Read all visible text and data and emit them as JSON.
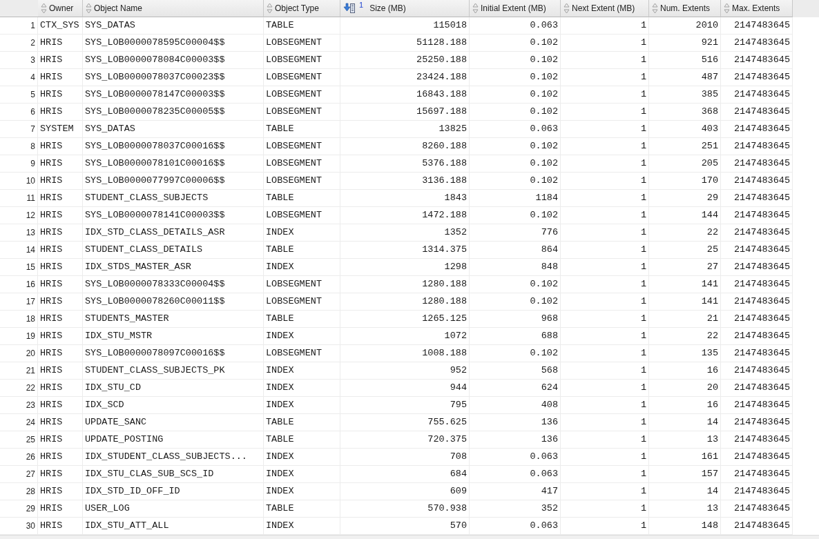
{
  "grid": {
    "columns": [
      {
        "label": "Owner",
        "kind": "text",
        "sorted": false
      },
      {
        "label": "Object Name",
        "kind": "text",
        "sorted": false
      },
      {
        "label": "Object Type",
        "kind": "text",
        "sorted": false
      },
      {
        "label": "Size (MB)",
        "kind": "number",
        "sorted": true,
        "sort_rank": "1"
      },
      {
        "label": "Initial Extent (MB)",
        "kind": "number",
        "sorted": false
      },
      {
        "label": "Next Extent (MB)",
        "kind": "number",
        "sorted": false
      },
      {
        "label": "Num. Extents",
        "kind": "number",
        "sorted": false
      },
      {
        "label": "Max. Extents",
        "kind": "number",
        "sorted": false
      }
    ],
    "rows": [
      {
        "number": "1",
        "cells": [
          "CTX_SYS",
          "SYS_DATAS",
          "TABLE",
          "115018",
          "0.063",
          "1",
          "2010",
          "2147483645"
        ]
      },
      {
        "number": "2",
        "cells": [
          "HRIS",
          "SYS_LOB0000078595C00004$$",
          "LOBSEGMENT",
          "51128.188",
          "0.102",
          "1",
          "921",
          "2147483645"
        ]
      },
      {
        "number": "3",
        "cells": [
          "HRIS",
          "SYS_LOB0000078084C00003$$",
          "LOBSEGMENT",
          "25250.188",
          "0.102",
          "1",
          "516",
          "2147483645"
        ]
      },
      {
        "number": "4",
        "cells": [
          "HRIS",
          "SYS_LOB0000078037C00023$$",
          "LOBSEGMENT",
          "23424.188",
          "0.102",
          "1",
          "487",
          "2147483645"
        ]
      },
      {
        "number": "5",
        "cells": [
          "HRIS",
          "SYS_LOB0000078147C00003$$",
          "LOBSEGMENT",
          "16843.188",
          "0.102",
          "1",
          "385",
          "2147483645"
        ]
      },
      {
        "number": "6",
        "cells": [
          "HRIS",
          "SYS_LOB0000078235C00005$$",
          "LOBSEGMENT",
          "15697.188",
          "0.102",
          "1",
          "368",
          "2147483645"
        ]
      },
      {
        "number": "7",
        "cells": [
          "SYSTEM",
          "SYS_DATAS",
          "TABLE",
          "13825",
          "0.063",
          "1",
          "403",
          "2147483645"
        ]
      },
      {
        "number": "8",
        "cells": [
          "HRIS",
          "SYS_LOB0000078037C00016$$",
          "LOBSEGMENT",
          "8260.188",
          "0.102",
          "1",
          "251",
          "2147483645"
        ]
      },
      {
        "number": "9",
        "cells": [
          "HRIS",
          "SYS_LOB0000078101C00016$$",
          "LOBSEGMENT",
          "5376.188",
          "0.102",
          "1",
          "205",
          "2147483645"
        ]
      },
      {
        "number": "10",
        "cells": [
          "HRIS",
          "SYS_LOB0000077997C00006$$",
          "LOBSEGMENT",
          "3136.188",
          "0.102",
          "1",
          "170",
          "2147483645"
        ]
      },
      {
        "number": "11",
        "cells": [
          "HRIS",
          "STUDENT_CLASS_SUBJECTS",
          "TABLE",
          "1843",
          "1184",
          "1",
          "29",
          "2147483645"
        ]
      },
      {
        "number": "12",
        "cells": [
          "HRIS",
          "SYS_LOB0000078141C00003$$",
          "LOBSEGMENT",
          "1472.188",
          "0.102",
          "1",
          "144",
          "2147483645"
        ]
      },
      {
        "number": "13",
        "cells": [
          "HRIS",
          "IDX_STD_CLASS_DETAILS_ASR",
          "INDEX",
          "1352",
          "776",
          "1",
          "22",
          "2147483645"
        ]
      },
      {
        "number": "14",
        "cells": [
          "HRIS",
          "STUDENT_CLASS_DETAILS",
          "TABLE",
          "1314.375",
          "864",
          "1",
          "25",
          "2147483645"
        ]
      },
      {
        "number": "15",
        "cells": [
          "HRIS",
          "IDX_STDS_MASTER_ASR",
          "INDEX",
          "1298",
          "848",
          "1",
          "27",
          "2147483645"
        ]
      },
      {
        "number": "16",
        "cells": [
          "HRIS",
          "SYS_LOB0000078333C00004$$",
          "LOBSEGMENT",
          "1280.188",
          "0.102",
          "1",
          "141",
          "2147483645"
        ]
      },
      {
        "number": "17",
        "cells": [
          "HRIS",
          "SYS_LOB0000078260C00011$$",
          "LOBSEGMENT",
          "1280.188",
          "0.102",
          "1",
          "141",
          "2147483645"
        ]
      },
      {
        "number": "18",
        "cells": [
          "HRIS",
          "STUDENTS_MASTER",
          "TABLE",
          "1265.125",
          "968",
          "1",
          "21",
          "2147483645"
        ]
      },
      {
        "number": "19",
        "cells": [
          "HRIS",
          "IDX_STU_MSTR",
          "INDEX",
          "1072",
          "688",
          "1",
          "22",
          "2147483645"
        ]
      },
      {
        "number": "20",
        "cells": [
          "HRIS",
          "SYS_LOB0000078097C00016$$",
          "LOBSEGMENT",
          "1008.188",
          "0.102",
          "1",
          "135",
          "2147483645"
        ]
      },
      {
        "number": "21",
        "cells": [
          "HRIS",
          "STUDENT_CLASS_SUBJECTS_PK",
          "INDEX",
          "952",
          "568",
          "1",
          "16",
          "2147483645"
        ]
      },
      {
        "number": "22",
        "cells": [
          "HRIS",
          "IDX_STU_CD",
          "INDEX",
          "944",
          "624",
          "1",
          "20",
          "2147483645"
        ]
      },
      {
        "number": "23",
        "cells": [
          "HRIS",
          "IDX_SCD",
          "INDEX",
          "795",
          "408",
          "1",
          "16",
          "2147483645"
        ]
      },
      {
        "number": "24",
        "cells": [
          "HRIS",
          "UPDATE_SANC",
          "TABLE",
          "755.625",
          "136",
          "1",
          "14",
          "2147483645"
        ]
      },
      {
        "number": "25",
        "cells": [
          "HRIS",
          "UPDATE_POSTING",
          "TABLE",
          "720.375",
          "136",
          "1",
          "13",
          "2147483645"
        ]
      },
      {
        "number": "26",
        "cells": [
          "HRIS",
          "IDX_STUDENT_CLASS_SUBJECTS...",
          "INDEX",
          "708",
          "0.063",
          "1",
          "161",
          "2147483645"
        ]
      },
      {
        "number": "27",
        "cells": [
          "HRIS",
          "IDX_STU_CLAS_SUB_SCS_ID",
          "INDEX",
          "684",
          "0.063",
          "1",
          "157",
          "2147483645"
        ]
      },
      {
        "number": "28",
        "cells": [
          "HRIS",
          "IDX_STD_ID_OFF_ID",
          "INDEX",
          "609",
          "417",
          "1",
          "14",
          "2147483645"
        ]
      },
      {
        "number": "29",
        "cells": [
          "HRIS",
          "USER_LOG",
          "TABLE",
          "570.938",
          "352",
          "1",
          "13",
          "2147483645"
        ]
      },
      {
        "number": "30",
        "cells": [
          "HRIS",
          "IDX_STU_ATT_ALL",
          "INDEX",
          "570",
          "0.063",
          "1",
          "148",
          "2147483645"
        ]
      }
    ]
  }
}
